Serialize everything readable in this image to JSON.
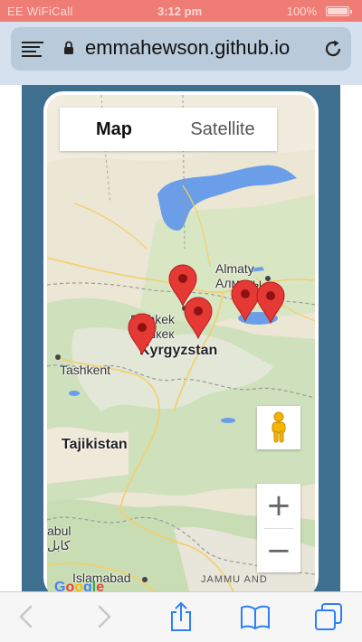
{
  "status_bar": {
    "carrier": "EE WiFiCall",
    "time": "3:12 pm",
    "battery_percent": "100%"
  },
  "browser": {
    "url": "emmahewson.github.io"
  },
  "map": {
    "type_options": [
      "Map",
      "Satellite"
    ],
    "selected_type": "Map",
    "zoom_in_label": "+",
    "zoom_out_label": "−",
    "labels": {
      "almaty": "Almaty",
      "almaty_cyr": "Алматы",
      "bishkek": "Bishkek",
      "bishkek_cyr": "Бишкек",
      "kyrgyzstan": "Kyrgyzstan",
      "tashkent": "Tashkent",
      "tajikistan": "Tajikistan",
      "kabul": "abul",
      "kabul_local": "کابل",
      "islamabad": "Islamabad",
      "jammu": "JAMMU AND"
    },
    "google_logo": "Google",
    "marker_count": 5
  },
  "colors": {
    "status_bar": "#ef7d75",
    "url_bar": "#d5e1ef",
    "page_panel": "#3f6f8e",
    "water": "#6a9ee8",
    "marker": "#e53935"
  },
  "toolbar": {
    "icons": [
      "back-icon",
      "forward-icon",
      "share-icon",
      "bookmarks-icon",
      "tabs-icon"
    ]
  }
}
